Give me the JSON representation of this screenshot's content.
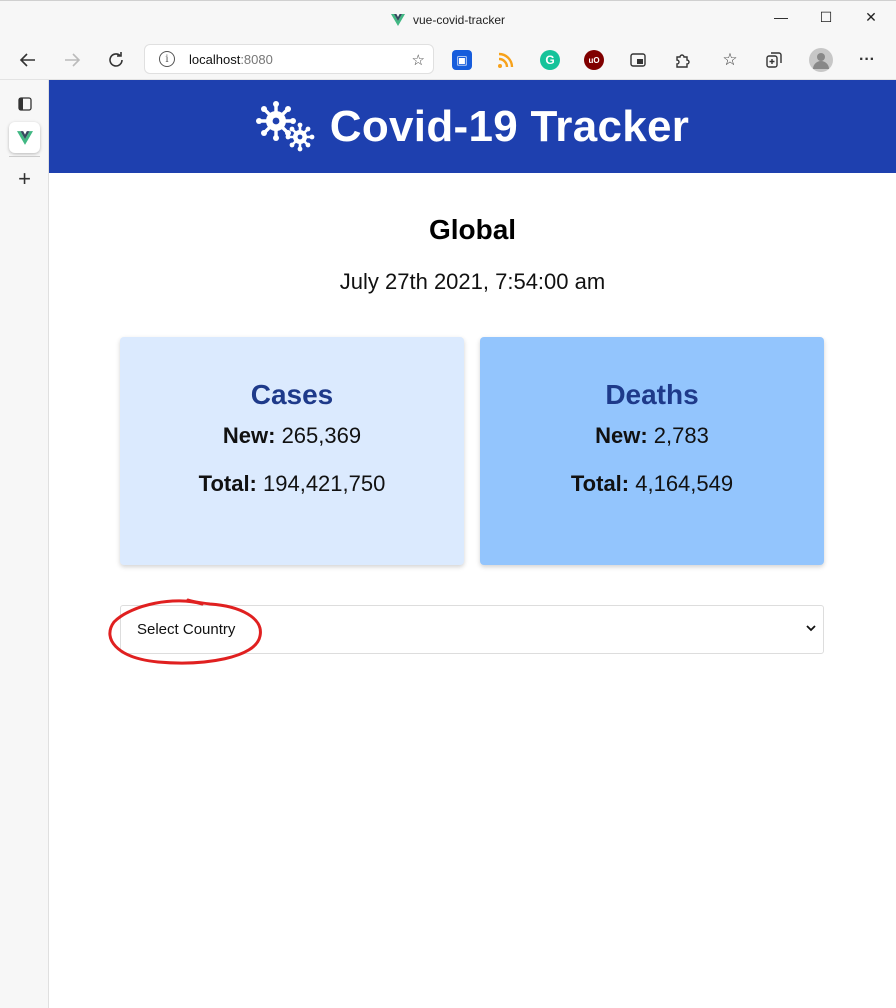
{
  "window": {
    "title": "vue-covid-tracker",
    "controls": {
      "minimize": "—",
      "maximize": "☐",
      "close": "✕"
    }
  },
  "toolbar": {
    "url_host": "localhost",
    "url_port": ":8080",
    "extension_icons": [
      "bitwarden-icon",
      "rss-icon",
      "grammarly-icon",
      "ublock-icon",
      "picture-in-picture-icon",
      "extensions-icon",
      "favorites-icon",
      "collections-icon",
      "profile-icon",
      "more-icon"
    ]
  },
  "sidebar": {
    "items": [
      "tab-actions-icon",
      "vue-devtools-tab",
      "add-icon"
    ]
  },
  "header": {
    "title": "Covid-19 Tracker",
    "bg_color": "#1e40af"
  },
  "stats": {
    "region": "Global",
    "date": "July 27th 2021, 7:54:00 am",
    "cases": {
      "title": "Cases",
      "new_label": "New:",
      "new_value": " 265,369",
      "total_label": "Total:",
      "total_value": " 194,421,750",
      "bg_color": "#dbeafe"
    },
    "deaths": {
      "title": "Deaths",
      "new_label": "New:",
      "new_value": " 2,783",
      "total_label": "Total:",
      "total_value": " 4,164,549",
      "bg_color": "#93c5fd"
    }
  },
  "country_select": {
    "selected": "Select Country"
  },
  "annotation": {
    "color": "#e02020"
  }
}
